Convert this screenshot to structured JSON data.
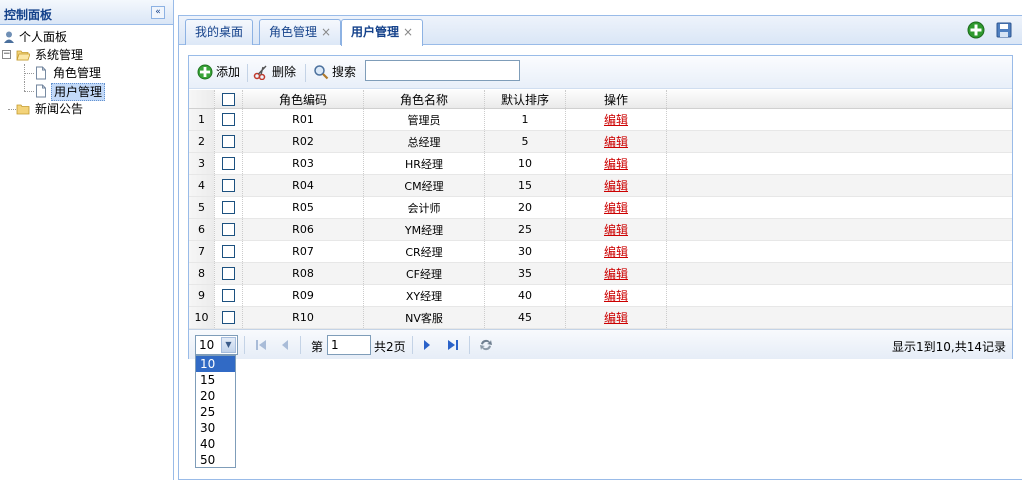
{
  "left": {
    "title": "控制面板",
    "collapse_glyph": "«",
    "tree": {
      "personal": "个人面板",
      "system": "系统管理",
      "role_mgmt": "角色管理",
      "user_mgmt": "用户管理",
      "news": "新闻公告",
      "expand_glyph": "−"
    }
  },
  "tabs": [
    {
      "label": "我的桌面",
      "close": ""
    },
    {
      "label": "角色管理",
      "close": "×"
    },
    {
      "label": "用户管理",
      "close": "×"
    }
  ],
  "toolbar": {
    "add_label": "添加",
    "delete_label": "删除",
    "search_label": "搜索",
    "search_value": ""
  },
  "grid": {
    "columns": [
      "角色编码",
      "角色名称",
      "默认排序",
      "操作"
    ],
    "edit_label": "编辑",
    "rows": [
      {
        "n": "1",
        "code": "R01",
        "name": "管理员",
        "sort": "1"
      },
      {
        "n": "2",
        "code": "R02",
        "name": "总经理",
        "sort": "5"
      },
      {
        "n": "3",
        "code": "R03",
        "name": "HR经理",
        "sort": "10"
      },
      {
        "n": "4",
        "code": "R04",
        "name": "CM经理",
        "sort": "15"
      },
      {
        "n": "5",
        "code": "R05",
        "name": "会计师",
        "sort": "20"
      },
      {
        "n": "6",
        "code": "R06",
        "name": "YM经理",
        "sort": "25"
      },
      {
        "n": "7",
        "code": "R07",
        "name": "CR经理",
        "sort": "30"
      },
      {
        "n": "8",
        "code": "R08",
        "name": "CF经理",
        "sort": "35"
      },
      {
        "n": "9",
        "code": "R09",
        "name": "XY经理",
        "sort": "40"
      },
      {
        "n": "10",
        "code": "R10",
        "name": "NV客服",
        "sort": "45"
      }
    ]
  },
  "pager": {
    "page_size": "10",
    "page_sizes": [
      "10",
      "15",
      "20",
      "25",
      "30",
      "40",
      "50"
    ],
    "page_prefix": "第",
    "page_value": "1",
    "page_total": "共2页",
    "info": "显示1到10,共14记录"
  },
  "colors": {
    "border": "#99bbe8",
    "title": "#15428b",
    "link": "#cc0000",
    "select": "#316ac5"
  }
}
